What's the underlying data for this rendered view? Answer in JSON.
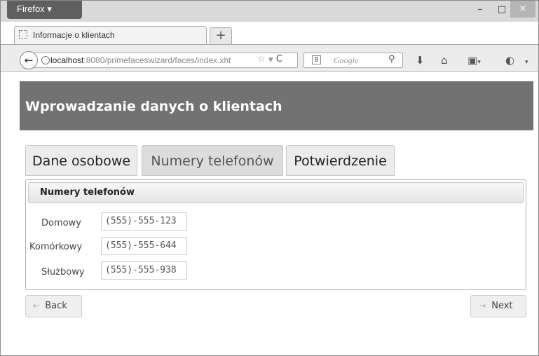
{
  "browser": {
    "firefox_label": "Firefox ▾",
    "tab_title": "Informacje o klientach",
    "newtab_label": "+",
    "url_host": "localhost",
    "url_rest": ":8080/primefaceswizard/faces/index.xht",
    "search_placeholder": "Google",
    "search_engine_glyph": "8",
    "window_controls": {
      "minimize": "–",
      "maximize": "□",
      "close": "×"
    }
  },
  "page": {
    "header_title": "Wprowadzanie danych o klientach",
    "wizard_tabs": [
      {
        "label": "Dane osobowe",
        "active": false
      },
      {
        "label": "Numery telefonów",
        "active": true
      },
      {
        "label": "Potwierdzenie",
        "active": false
      }
    ],
    "panel_title": "Numery telefonów",
    "fields": [
      {
        "label": "Domowy",
        "value": "(555)-555-123"
      },
      {
        "label": "Komórkowy",
        "value": "(555)-555-644"
      },
      {
        "label": "Służbowy",
        "value": "(555)-555-938"
      }
    ],
    "back_label": "Back",
    "next_label": "Next",
    "back_arrow": "←",
    "next_arrow": "→"
  }
}
